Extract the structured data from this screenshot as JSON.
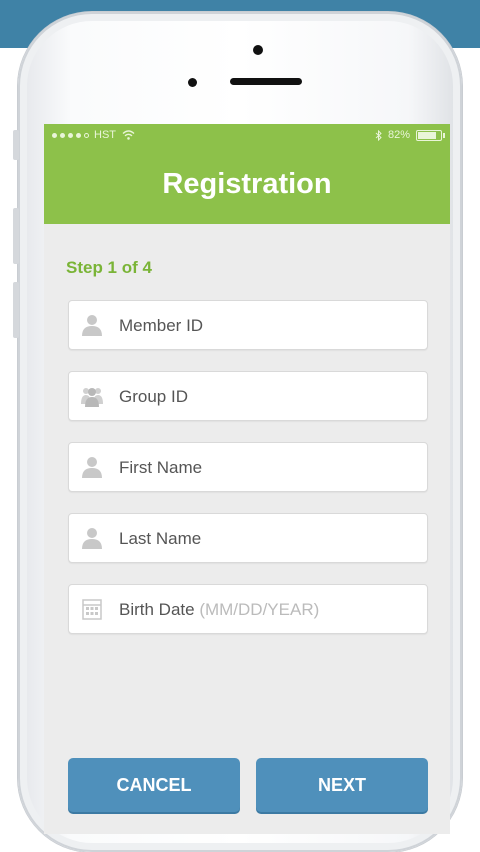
{
  "status_bar": {
    "carrier": "HST",
    "battery_text": "82%"
  },
  "header": {
    "title": "Registration"
  },
  "step": "Step 1 of 4",
  "fields": [
    {
      "label": "Member ID",
      "icon": "person-icon"
    },
    {
      "label": "Group ID",
      "icon": "group-icon"
    },
    {
      "label": "First Name",
      "icon": "person-icon"
    },
    {
      "label": "Last Name",
      "icon": "person-icon"
    },
    {
      "label": "Birth Date",
      "placeholder": "(MM/DD/YEAR)",
      "icon": "calendar-icon"
    }
  ],
  "buttons": {
    "cancel": "CANCEL",
    "next": "NEXT"
  },
  "colors": {
    "header_green": "#8dc14a",
    "step_green": "#7ab437",
    "button_blue": "#4f90bb",
    "top_band": "#3f82a6"
  }
}
